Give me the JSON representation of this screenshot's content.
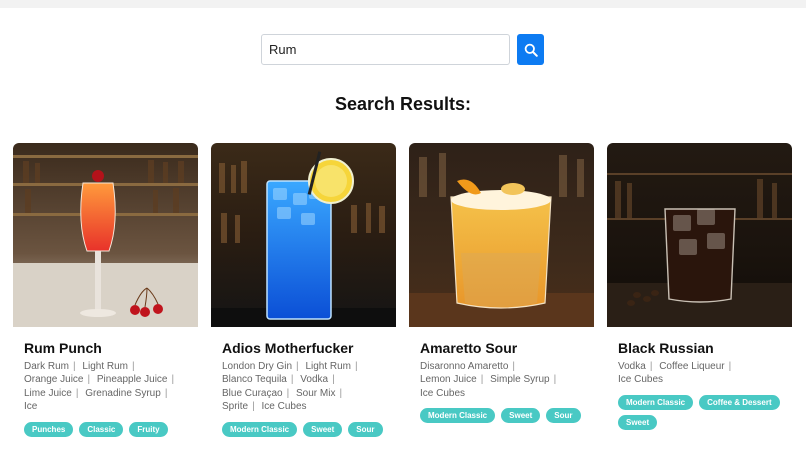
{
  "search": {
    "value": "Rum",
    "placeholder": ""
  },
  "results_title": "Search Results:",
  "colors": {
    "accent": "#0d7bf2",
    "tag": "#49c9c4"
  },
  "cards": [
    {
      "name": "Rum Punch",
      "ingredients": [
        "Dark Rum",
        "Light Rum",
        "Orange Juice",
        "Pineapple Juice",
        "Lime Juice",
        "Grenadine Syrup",
        "Ice"
      ],
      "tags": [
        "Punches",
        "Classic",
        "Fruity"
      ],
      "image": "red-orange-punch-cocktail-with-cherries"
    },
    {
      "name": "Adios Motherfucker",
      "ingredients": [
        "London Dry Gin",
        "Light Rum",
        "Blanco Tequila",
        "Vodka",
        "Blue Curaçao",
        "Sour Mix",
        "Sprite",
        "Ice Cubes"
      ],
      "tags": [
        "Modern Classic",
        "Sweet",
        "Sour"
      ],
      "image": "blue-highball-cocktail-with-lemon"
    },
    {
      "name": "Amaretto Sour",
      "ingredients": [
        "Disaronno Amaretto",
        "Lemon Juice",
        "Simple Syrup",
        "Ice Cubes"
      ],
      "tags": [
        "Modern Classic",
        "Sweet",
        "Sour"
      ],
      "image": "amber-sour-cocktail-with-orange-peel"
    },
    {
      "name": "Black Russian",
      "ingredients": [
        "Vodka",
        "Coffee Liqueur",
        "Ice Cubes"
      ],
      "tags": [
        "Modern Classic",
        "Coffee & Dessert",
        "Sweet"
      ],
      "image": "dark-coffee-cocktail-on-rocks"
    }
  ]
}
